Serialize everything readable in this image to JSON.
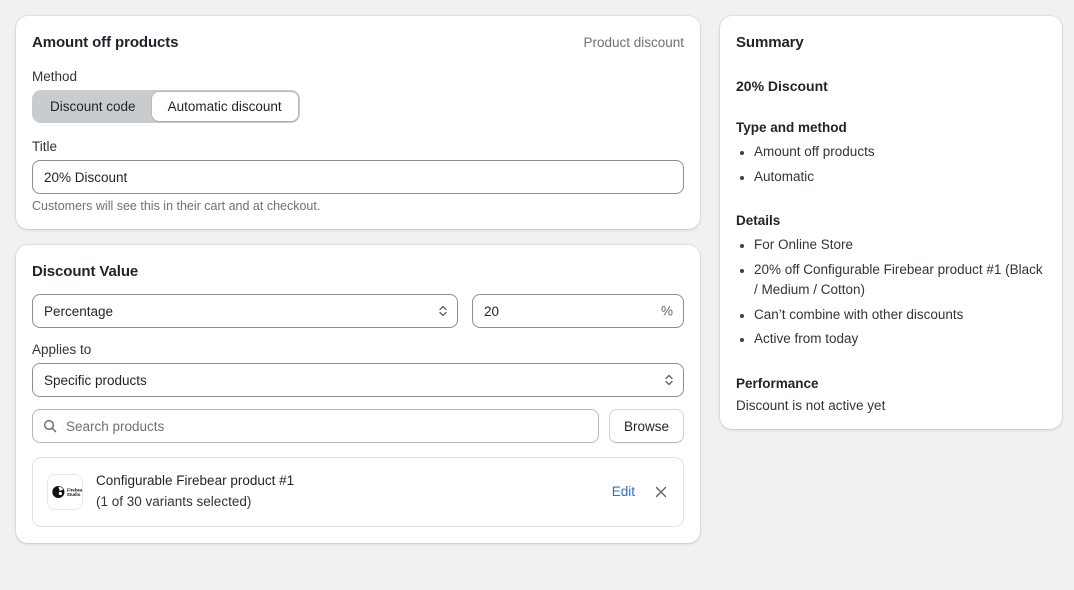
{
  "colors": {
    "page_bg": "#f1f1f1",
    "card_bg": "#ffffff",
    "text": "#1f2329",
    "muted": "#6b7177",
    "link": "#2c6ecb",
    "segment_track": "#c9cccf"
  },
  "discount_card": {
    "title": "Amount off products",
    "type_label": "Product discount",
    "method_label": "Method",
    "method_options": [
      {
        "label": "Discount code",
        "selected": false
      },
      {
        "label": "Automatic discount",
        "selected": true
      }
    ],
    "title_field_label": "Title",
    "title_value": "20% Discount",
    "title_placeholder": "",
    "title_help": "Customers will see this in their cart and at checkout."
  },
  "value_card": {
    "title": "Discount Value",
    "value_type": "Percentage",
    "amount": "20",
    "amount_suffix": "%",
    "applies_to_label": "Applies to",
    "applies_to_value": "Specific products",
    "search_placeholder": "Search products",
    "search_value": "",
    "browse_label": "Browse",
    "products": [
      {
        "thumb_brand_line1": "Firebear",
        "thumb_brand_line2": "Studio",
        "name": "Configurable Firebear product #1",
        "variants": "(1 of 30 variants selected)",
        "edit_label": "Edit",
        "remove_label": "×"
      }
    ]
  },
  "summary": {
    "title": "Summary",
    "discount_name": "20% Discount",
    "sections": [
      {
        "heading": "Type and method",
        "items": [
          "Amount off products",
          "Automatic"
        ]
      },
      {
        "heading": "Details",
        "items": [
          "For Online Store",
          "20% off Configurable Firebear product #1 (Black / Medium / Cotton)",
          "Can’t combine with other discounts",
          "Active from today"
        ]
      }
    ],
    "performance_heading": "Performance",
    "performance_text": "Discount is not active yet"
  },
  "icons": {
    "select_chevrons": "chevron-up-down-icon",
    "search": "search-icon",
    "close": "close-icon"
  }
}
